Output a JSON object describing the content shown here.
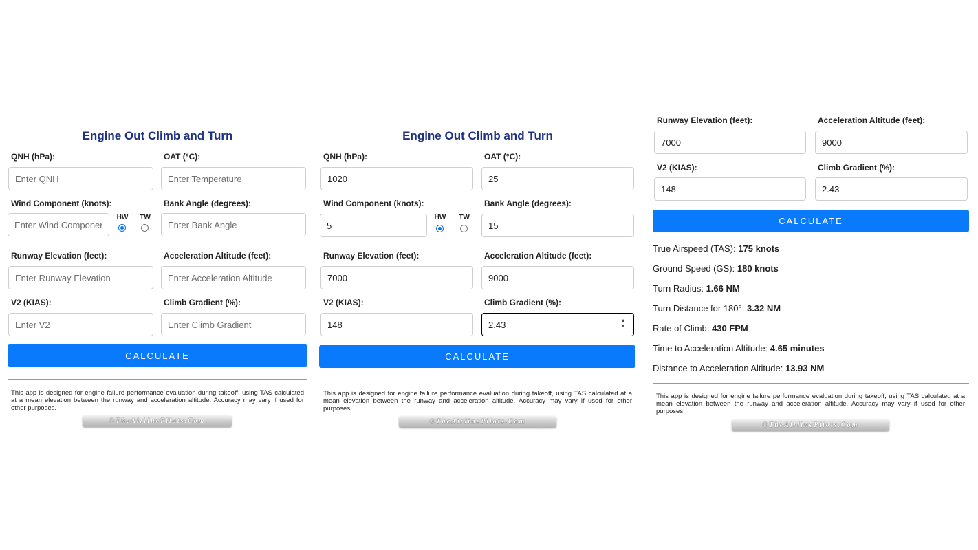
{
  "panel1": {
    "title": "Engine Out Climb and Turn",
    "qnh_label": "QNH (hPa):",
    "qnh_placeholder": "Enter QNH",
    "qnh_value": "",
    "oat_label": "OAT (°C):",
    "oat_placeholder": "Enter Temperature",
    "oat_value": "",
    "wind_label": "Wind Component (knots):",
    "wind_placeholder": "Enter Wind Component",
    "wind_value": "",
    "hw_label": "HW",
    "tw_label": "TW",
    "wind_selected": "HW",
    "bank_label": "Bank Angle (degrees):",
    "bank_placeholder": "Enter Bank Angle",
    "bank_value": "",
    "rwy_label": "Runway Elevation (feet):",
    "rwy_placeholder": "Enter Runway Elevation",
    "rwy_value": "",
    "acc_label": "Acceleration Altitude (feet):",
    "acc_placeholder": "Enter Acceleration Altitude",
    "acc_value": "",
    "v2_label": "V2 (KIAS):",
    "v2_placeholder": "Enter V2",
    "v2_value": "",
    "grad_label": "Climb Gradient (%):",
    "grad_placeholder": "Enter Climb Gradient",
    "grad_value": "",
    "calculate_label": "CALCULATE",
    "disclaimer": "This app is designed for engine failure performance evaluation during takeoff, using TAS calculated at a mean elevation between the runway and acceleration altitude. Accuracy may vary if used for other purposes.",
    "logo_text": "©TheAirlinePilots.Com"
  },
  "panel2": {
    "title": "Engine Out Climb and Turn",
    "qnh_label": "QNH (hPa):",
    "qnh_value": "1020",
    "oat_label": "OAT (°C):",
    "oat_value": "25",
    "wind_label": "Wind Component (knots):",
    "wind_value": "5",
    "hw_label": "HW",
    "tw_label": "TW",
    "wind_selected": "HW",
    "bank_label": "Bank Angle (degrees):",
    "bank_value": "15",
    "rwy_label": "Runway Elevation (feet):",
    "rwy_value": "7000",
    "acc_label": "Acceleration Altitude (feet):",
    "acc_value": "9000",
    "v2_label": "V2 (KIAS):",
    "v2_value": "148",
    "grad_label": "Climb Gradient (%):",
    "grad_value": "2.43",
    "calculate_label": "CALCULATE",
    "disclaimer": "This app is designed for engine failure performance evaluation during takeoff, using TAS calculated at a mean elevation between the runway and acceleration altitude. Accuracy may vary if used for other purposes.",
    "logo_text": "©TheAirlinePilots.Com"
  },
  "panel3": {
    "rwy_label": "Runway Elevation (feet):",
    "rwy_value": "7000",
    "acc_label": "Acceleration Altitude (feet):",
    "acc_value": "9000",
    "v2_label": "V2 (KIAS):",
    "v2_value": "148",
    "grad_label": "Climb Gradient (%):",
    "grad_value": "2.43",
    "calculate_label": "CALCULATE",
    "results": [
      {
        "label": "True Airspeed (TAS):",
        "value": "175 knots"
      },
      {
        "label": "Ground Speed (GS):",
        "value": "180 knots"
      },
      {
        "label": "Turn Radius:",
        "value": "1.66 NM"
      },
      {
        "label": "Turn Distance for 180°:",
        "value": "3.32 NM"
      },
      {
        "label": "Rate of Climb:",
        "value": "430 FPM"
      },
      {
        "label": "Time to Acceleration Altitude:",
        "value": "4.65 minutes"
      },
      {
        "label": "Distance to Acceleration Altitude:",
        "value": "13.93 NM"
      }
    ],
    "disclaimer": "This app is designed for engine failure performance evaluation during takeoff, using TAS calculated at a mean elevation between the runway and acceleration altitude. Accuracy may vary if used for other purposes.",
    "logo_text": "©TheAirlinePilots.Com"
  },
  "colors": {
    "accent": "#0a7afc",
    "title": "#1e3282",
    "radio": "#0a6fe8"
  }
}
